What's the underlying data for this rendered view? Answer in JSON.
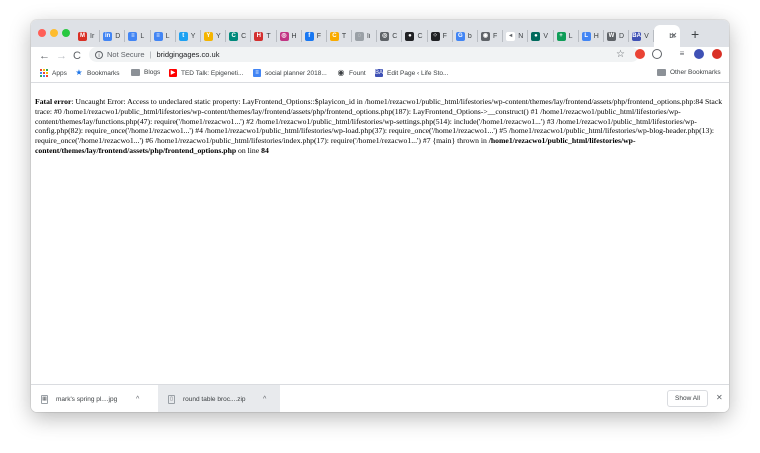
{
  "browser": {
    "tabs": [
      {
        "label": "Ir",
        "icon": "gmail-icon",
        "color": "#d93025",
        "glyph": "M"
      },
      {
        "label": "D",
        "icon": "tab-app-icon",
        "color": "#4285f4",
        "glyph": "in"
      },
      {
        "label": "L",
        "icon": "docs-icon",
        "color": "#4285f4",
        "glyph": "≡"
      },
      {
        "label": "L",
        "icon": "docs-icon",
        "color": "#4285f4",
        "glyph": "≡"
      },
      {
        "label": "Y",
        "icon": "twitter-icon",
        "color": "#1da1f2",
        "glyph": "t"
      },
      {
        "label": "Y",
        "icon": "page-icon",
        "color": "#f4b400",
        "glyph": "Y"
      },
      {
        "label": "C",
        "icon": "page-icon",
        "color": "#00897b",
        "glyph": "C"
      },
      {
        "label": "T",
        "icon": "page-icon",
        "color": "#d32f2f",
        "glyph": "H"
      },
      {
        "label": "H",
        "icon": "instagram-icon",
        "color": "#c13584",
        "glyph": "◎"
      },
      {
        "label": "F",
        "icon": "facebook-icon",
        "color": "#1877f2",
        "glyph": "f"
      },
      {
        "label": "T",
        "icon": "page-icon",
        "color": "#f9ab00",
        "glyph": "C"
      },
      {
        "label": "li",
        "icon": "loading-icon",
        "color": "#9aa0a6",
        "glyph": "◌"
      },
      {
        "label": "C",
        "icon": "page-icon",
        "color": "#5f6368",
        "glyph": "◎"
      },
      {
        "label": "C",
        "icon": "page-icon",
        "color": "#202124",
        "glyph": "●"
      },
      {
        "label": "F",
        "icon": "page-icon",
        "color": "#202124",
        "glyph": "⁘"
      },
      {
        "label": "b",
        "icon": "google-icon",
        "color": "#4285f4",
        "glyph": "G"
      },
      {
        "label": "F",
        "icon": "page-icon",
        "color": "#5f6368",
        "glyph": "◉"
      },
      {
        "label": "N",
        "icon": "audio-icon",
        "color": "#ffffff",
        "glyph": "◂"
      },
      {
        "label": "V",
        "icon": "page-icon",
        "color": "#00695c",
        "glyph": "●"
      },
      {
        "label": "L",
        "icon": "sheets-icon",
        "color": "#0f9d58",
        "glyph": "+"
      },
      {
        "label": "H",
        "icon": "docs-icon",
        "color": "#4285f4",
        "glyph": "L"
      },
      {
        "label": "D",
        "icon": "wordpress-icon",
        "color": "#5f6368",
        "glyph": "W"
      },
      {
        "label": "V",
        "icon": "page-icon",
        "color": "#3f51b5",
        "glyph": "BA"
      },
      {
        "label": "br",
        "icon": "page-icon",
        "color": "#ffffff",
        "glyph": "",
        "active": true
      }
    ],
    "new_tab": "+",
    "active_close": "✕",
    "toolbar": {
      "back": "←",
      "forward": "→",
      "reload": "C",
      "info": "i",
      "secure_label": "Not Secure",
      "separator": "|",
      "url": "bridgingages.co.uk",
      "star": "☆"
    },
    "bookmarks": [
      {
        "label": "Apps",
        "icon": "apps-grid-icon"
      },
      {
        "label": "Bookmarks",
        "icon": "star-icon",
        "glyph": "★",
        "color": "#1a73e8"
      },
      {
        "label": "Blogs",
        "icon": "folder-icon"
      },
      {
        "label": "TED Talk: Epigeneti...",
        "icon": "youtube-icon",
        "glyph": "▶",
        "color": "#ff0000"
      },
      {
        "label": "social planner 2018...",
        "icon": "docs-icon",
        "glyph": "≡",
        "color": "#4285f4"
      },
      {
        "label": "Fount",
        "icon": "fount-icon",
        "glyph": "◉",
        "color": "#3c4043"
      },
      {
        "label": "Edit Page ‹ Life Sto...",
        "icon": "page-icon",
        "glyph": "BA",
        "color": "#3f51b5"
      }
    ],
    "other_bookmarks": "Other Bookmarks"
  },
  "error": {
    "heading": "Fatal error",
    "message": ": Uncaught Error: Access to undeclared static property: LayFrontend_Options::$playicon_id in /home1/rezacwo1/public_html/lifestories/wp-content/themes/lay/frontend/assets/php/frontend_options.php:84 Stack trace: #0 /home1/rezacwo1/public_html/lifestories/wp-content/themes/lay/frontend/assets/php/frontend_options.php(187): LayFrontend_Options->__construct() #1 /home1/rezacwo1/public_html/lifestories/wp-content/themes/lay/functions.php(47): require('/home1/rezacwo1...') #2 /home1/rezacwo1/public_html/lifestories/wp-settings.php(514): include('/home1/rezacwo1...') #3 /home1/rezacwo1/public_html/lifestories/wp-config.php(82): require_once('/home1/rezacwo1...') #4 /home1/rezacwo1/public_html/lifestories/wp-load.php(37): require_once('/home1/rezacwo1...') #5 /home1/rezacwo1/public_html/lifestories/wp-blog-header.php(13): require_once('/home1/rezacwo1...') #6 /home1/rezacwo1/public_html/lifestories/index.php(17): require('/home1/rezacwo1...') #7 {main} thrown in ",
    "file": "/home1/rezacwo1/public_html/lifestories/wp-content/themes/lay/frontend/assets/php/frontend_options.php",
    "on_line": " on line ",
    "line": "84"
  },
  "downloads": {
    "items": [
      {
        "name": "mark's spring pl....jpg",
        "icon": "image-file-icon",
        "glyph": "▦"
      },
      {
        "name": "round table broc....zip",
        "icon": "zip-file-icon",
        "glyph": "▯"
      }
    ],
    "chevron": "^",
    "show_all": "Show All",
    "close": "✕"
  }
}
